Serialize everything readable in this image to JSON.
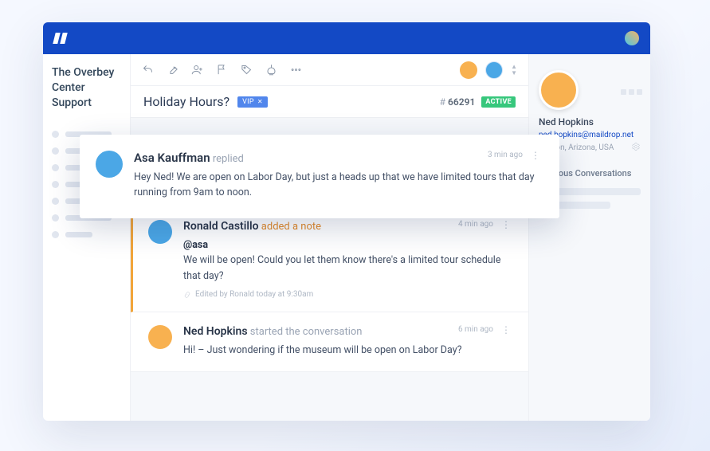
{
  "sidebar": {
    "title": "The Overbey Center Support"
  },
  "subject": {
    "title": "Holiday Hours?",
    "vip_label": "VIP",
    "id_prefix": "#",
    "id_number": "66291",
    "status": "ACTIVE"
  },
  "float_reply": {
    "author": "Asa Kauffman",
    "action": "replied",
    "time": "3 min ago",
    "text": "Hey Ned! We are open on Labor Day, but just a heads up that we have limited tours that day running from 9am to noon."
  },
  "note": {
    "author": "Ronald Castillo",
    "action": "added a note",
    "time": "4 min ago",
    "mention": "@asa",
    "text": "We will be open! Could you let them know there's a limited tour schedule that day?",
    "edited": "Edited by Ronald today at 9:30am"
  },
  "origin": {
    "author": "Ned Hopkins",
    "action": "started the conversation",
    "time": "6 min ago",
    "text": "Hi! – Just wondering if the museum will be open on Labor Day?"
  },
  "details": {
    "name": "Ned Hopkins",
    "email": "ned.hopkins@maildrop.net",
    "location": "Tucson, Arizona, USA",
    "section": "Previous Conversations"
  }
}
